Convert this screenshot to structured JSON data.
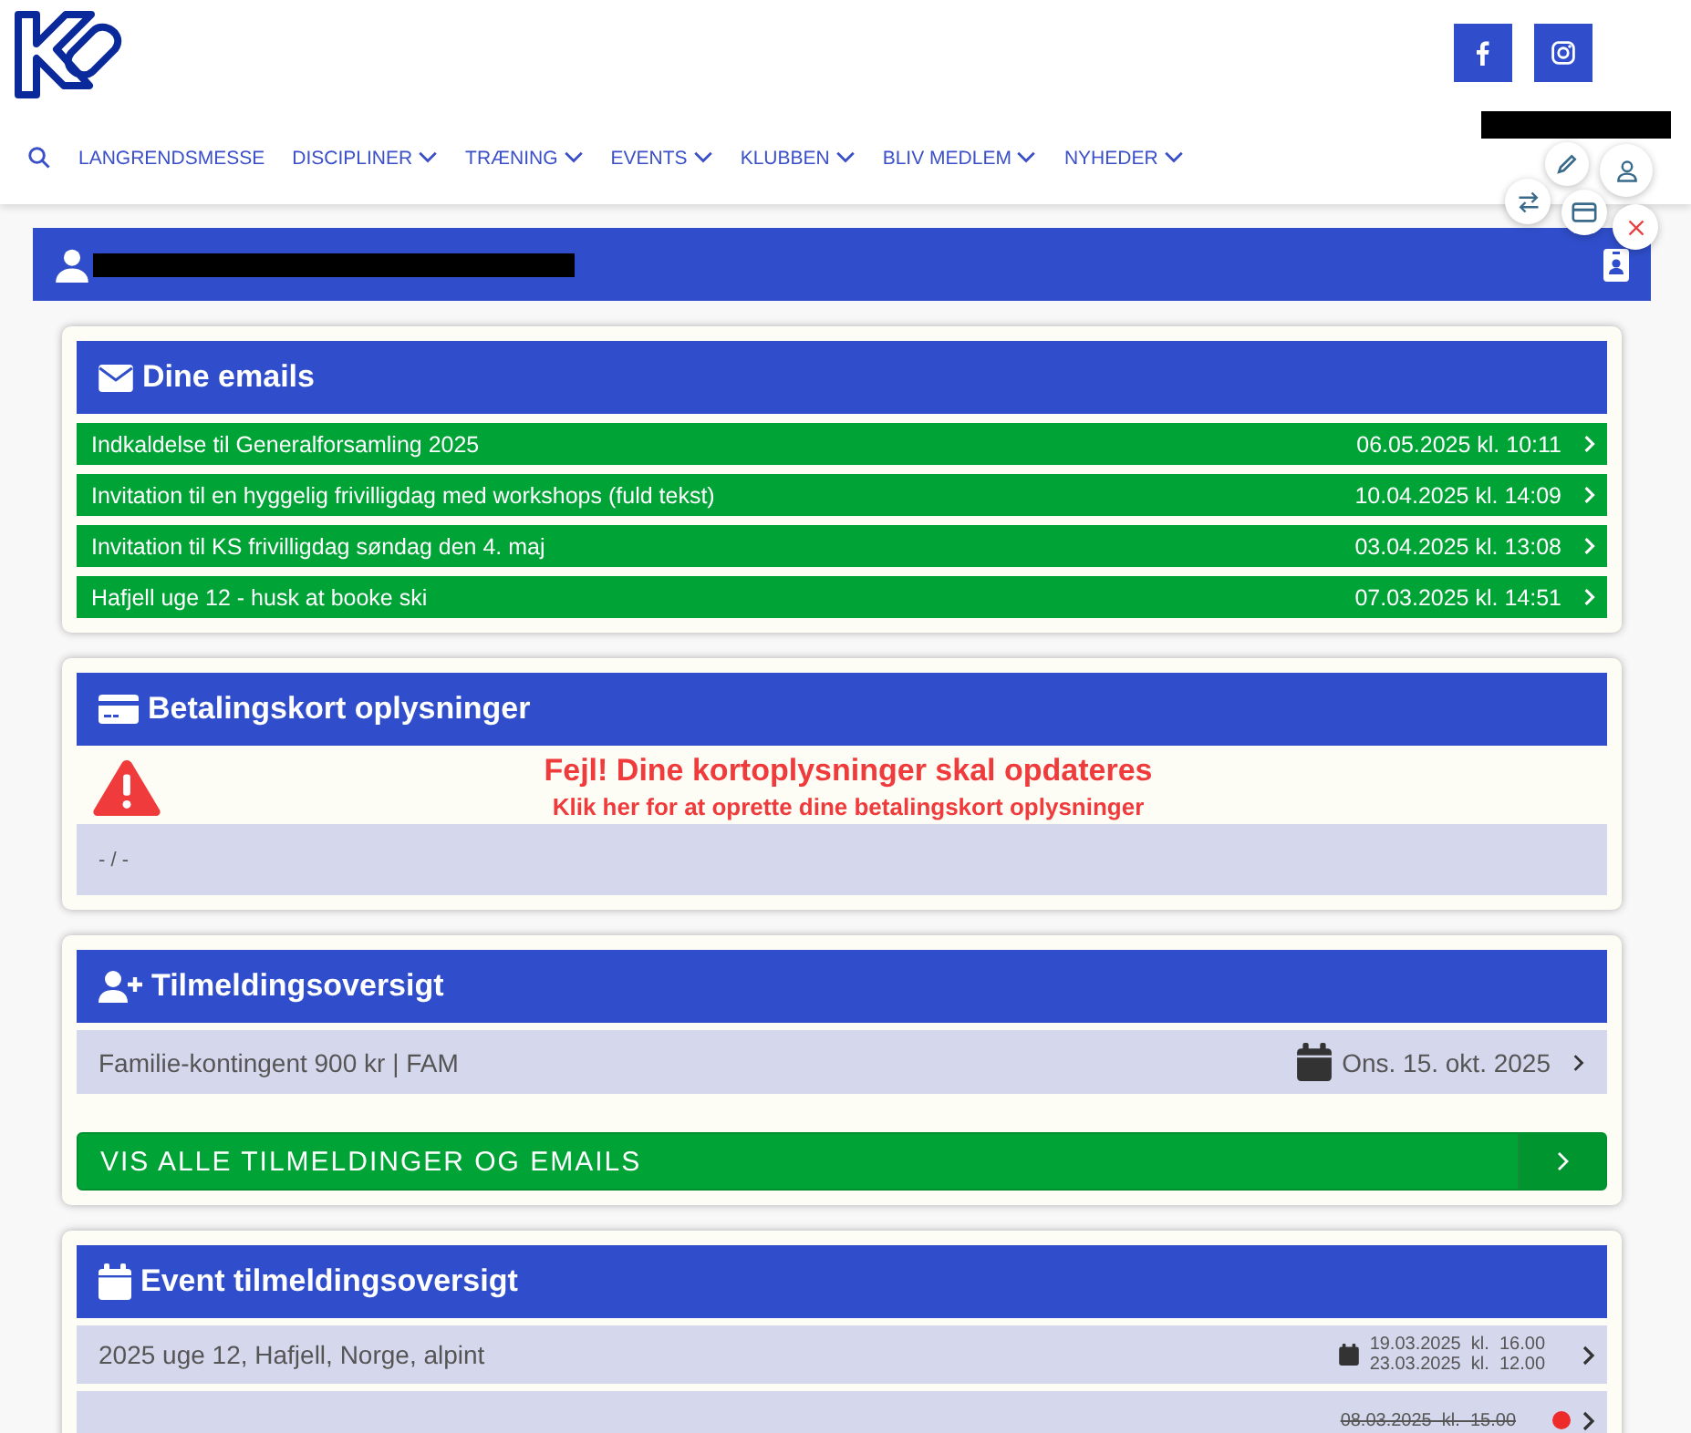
{
  "nav": {
    "items": [
      {
        "label": "LANGRENDSMESSE",
        "dropdown": false
      },
      {
        "label": "DISCIPLINER",
        "dropdown": true
      },
      {
        "label": "TRÆNING",
        "dropdown": true
      },
      {
        "label": "EVENTS",
        "dropdown": true
      },
      {
        "label": "KLUBBEN",
        "dropdown": true
      },
      {
        "label": "BLIV MEDLEM",
        "dropdown": true
      },
      {
        "label": "NYHEDER",
        "dropdown": true
      }
    ]
  },
  "emails": {
    "title": "Dine emails",
    "rows": [
      {
        "subject": "Indkaldelse til Generalforsamling 2025",
        "date": "06.05.2025 kl. 10:11"
      },
      {
        "subject": "Invitation til en hyggelig frivilligdag med workshops (fuld tekst)",
        "date": "10.04.2025 kl. 14:09"
      },
      {
        "subject": "Invitation til KS frivilligdag søndag den 4. maj",
        "date": "03.04.2025 kl. 13:08"
      },
      {
        "subject": "Hafjell uge 12 - husk at booke ski",
        "date": "07.03.2025 kl. 14:51"
      }
    ]
  },
  "payment": {
    "title": "Betalingskort oplysninger",
    "error": "Fejl! Dine kortoplysninger skal opdateres",
    "link": "Klik her for at oprette dine betalingskort oplysninger",
    "card": "- / -"
  },
  "registrations": {
    "title": "Tilmeldingsoversigt",
    "rows": [
      {
        "name": "Familie-kontingent 900 kr | FAM",
        "date": "Ons. 15. okt. 2025"
      }
    ],
    "button": "VIS ALLE TILMELDINGER OG EMAILS"
  },
  "events": {
    "title": "Event tilmeldingsoversigt",
    "rows": [
      {
        "name": "2025 uge 12, Hafjell, Norge, alpint",
        "start": "19.03.2025  kl.  16.00",
        "end": "23.03.2025  kl.  12.00",
        "cancelled": false
      },
      {
        "start": "08.03.2025  kl.  15.00",
        "cancelled": true
      }
    ]
  }
}
